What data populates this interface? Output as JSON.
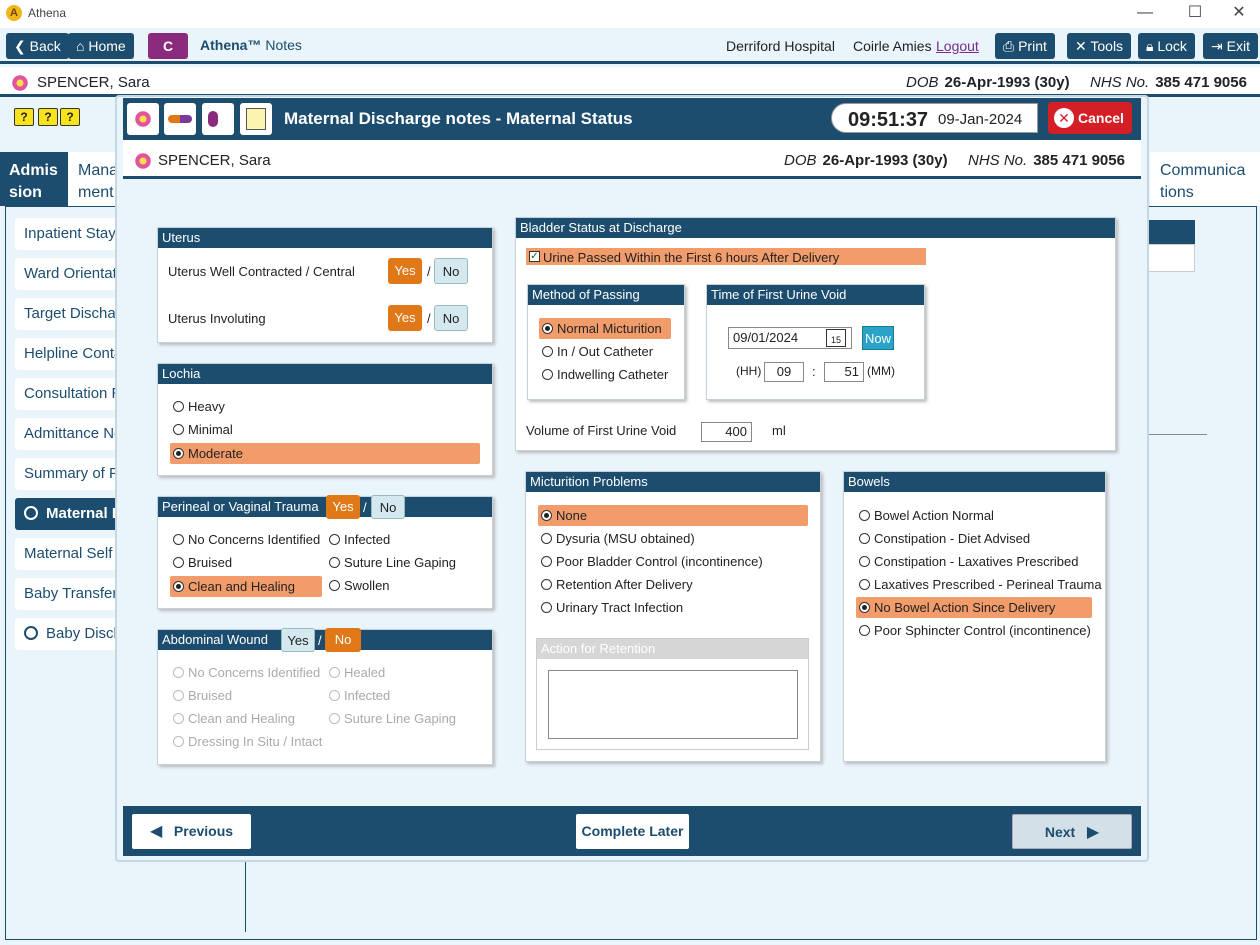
{
  "app": {
    "title": "Athena",
    "logo_letter": "A"
  },
  "window": {
    "minimize": "—",
    "maximize": "☐",
    "close": "✕"
  },
  "toolbar": {
    "back": "Back",
    "home": "Home",
    "c": "C",
    "brand": "Athena™",
    "brand_suffix": "Notes",
    "hospital": "Derriford Hospital",
    "user": "Coirle Amies",
    "logout": "Logout",
    "print": "Print",
    "tools": "Tools",
    "lock": "Lock",
    "exit": "Exit"
  },
  "patient": {
    "name": "SPENCER, Sara",
    "dob_label": "DOB",
    "dob": "26-Apr-1993 (30y)",
    "nhs_label": "NHS No.",
    "nhs": "385 471 9056"
  },
  "tabs": {
    "admission": "Admis sion",
    "management": "Mana ment",
    "communications": "Communica tions"
  },
  "sidebar": [
    {
      "label": "Inpatient Stay"
    },
    {
      "label": "Ward Orientati"
    },
    {
      "label": "Target Dischar"
    },
    {
      "label": "Helpline Conta"
    },
    {
      "label": "Consultation R"
    },
    {
      "label": "Admittance No"
    },
    {
      "label": "Summary of P"
    },
    {
      "label": "Maternal Di"
    },
    {
      "label": "Maternal Self"
    },
    {
      "label": "Baby Transfer"
    },
    {
      "label": "Baby Discha"
    }
  ],
  "modal": {
    "title": "Maternal Discharge notes - Maternal Status",
    "time": "09:51:37",
    "date": "09-Jan-2024",
    "cancel": "Cancel"
  },
  "uterus": {
    "title": "Uterus",
    "q1": "Uterus Well Contracted / Central",
    "q2": "Uterus Involuting",
    "yes": "Yes",
    "no": "No",
    "slash": "/"
  },
  "lochia": {
    "title": "Lochia",
    "options": [
      "Heavy",
      "Minimal",
      "Moderate"
    ]
  },
  "perineal": {
    "title": "Perineal or Vaginal Trauma",
    "yes": "Yes",
    "no": "No",
    "options": [
      "No Concerns Identified",
      "Infected",
      "Bruised",
      "Suture Line Gaping",
      "Clean and Healing",
      "Swollen"
    ]
  },
  "abdominal": {
    "title": "Abdominal Wound",
    "yes": "Yes",
    "no": "No",
    "options": [
      "No Concerns Identified",
      "Healed",
      "Bruised",
      "Infected",
      "Clean and Healing",
      "Suture Line Gaping",
      "Dressing In Situ / Intact"
    ]
  },
  "bladder": {
    "title": "Bladder Status at Discharge",
    "urine_passed": "Urine Passed Within the First 6 hours After Delivery",
    "method_title": "Method of Passing",
    "methods": [
      "Normal Micturition",
      "In / Out Catheter",
      "Indwelling Catheter"
    ],
    "time_title": "Time of First Urine Void",
    "date_value": "09/01/2024",
    "cal": "15",
    "now": "Now",
    "hh_label": "(HH)",
    "hh": "09",
    "colon": ":",
    "mm": "51",
    "mm_label": "(MM)",
    "volume_label": "Volume of First Urine Void",
    "volume": "400",
    "unit": "ml"
  },
  "micturition": {
    "title": "Micturition Problems",
    "options": [
      "None",
      "Dysuria (MSU obtained)",
      "Poor Bladder Control (incontinence)",
      "Retention After Delivery",
      "Urinary Tract Infection"
    ],
    "action_title": "Action for Retention"
  },
  "bowels": {
    "title": "Bowels",
    "options": [
      "Bowel Action Normal",
      "Constipation - Diet Advised",
      "Constipation - Laxatives Prescribed",
      "Laxatives Prescribed - Perineal Trauma",
      "No Bowel Action Since Delivery",
      "Poor Sphincter Control (incontinence)"
    ]
  },
  "footer": {
    "previous": "Previous",
    "complete_later": "Complete Later",
    "next": "Next"
  },
  "colors": {
    "primary": "#1c4d6e",
    "accent": "#e07818",
    "selected": "#f39c6b",
    "cancel": "#d41f26"
  }
}
